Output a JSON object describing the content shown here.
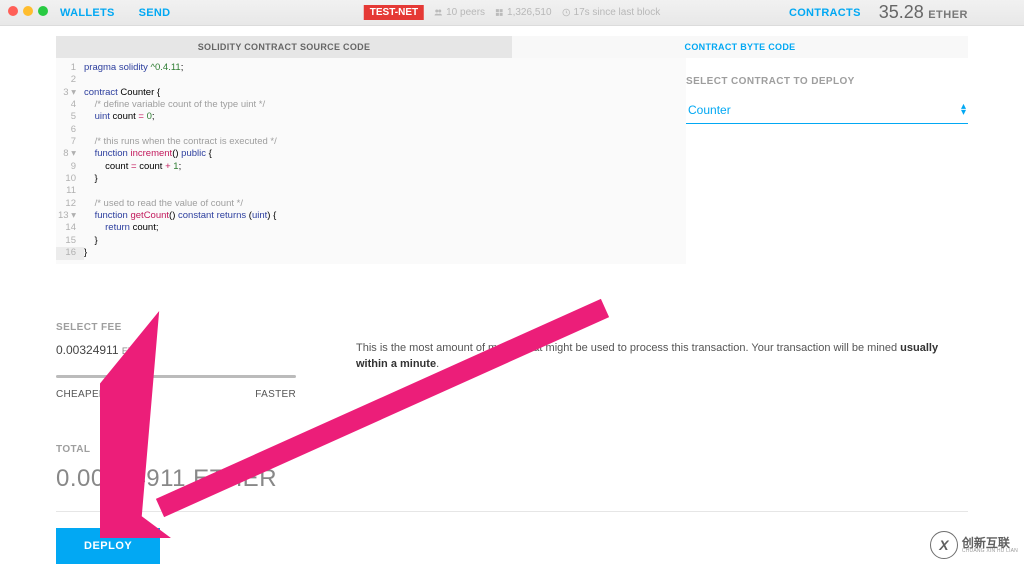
{
  "topbar": {
    "wallets": "WALLETS",
    "send": "SEND",
    "badge": "TEST-NET",
    "peers": "10 peers",
    "block": "1,326,510",
    "since": "17s since last block",
    "contracts": "CONTRACTS",
    "balance_amount": "35.28",
    "balance_unit": "ETHER"
  },
  "tabs": {
    "source": "SOLIDITY CONTRACT SOURCE CODE",
    "byte": "CONTRACT BYTE CODE"
  },
  "code": {
    "l1": "pragma solidity ^0.4.11;",
    "l2": "",
    "l3": "contract Counter {",
    "l4": "    /* define variable count of the type uint */",
    "l5": "    uint count = 0;",
    "l6": "",
    "l7": "    /* this runs when the contract is executed */",
    "l8": "    function increment() public {",
    "l9": "        count = count + 1;",
    "l10": "    }",
    "l11": "",
    "l12": "    /* used to read the value of count */",
    "l13": "    function getCount() constant returns (uint) {",
    "l14": "        return count;",
    "l15": "    }",
    "l16": "}"
  },
  "deploy": {
    "label": "SELECT CONTRACT TO DEPLOY",
    "selected": "Counter"
  },
  "fee": {
    "label": "SELECT FEE",
    "value": "0.00324911",
    "unit": "ETHER",
    "cheaper": "CHEAPER",
    "faster": "FASTER",
    "info_pre": "This is the most amount of money that might be used to process this transaction. Your transaction will be mined ",
    "info_bold": "usually within a minute",
    "info_post": "."
  },
  "total": {
    "label": "TOTAL",
    "value": "0.00324911 ETHER"
  },
  "button": {
    "deploy": "DEPLOY"
  },
  "watermark": {
    "cn": "创新互联",
    "py": "CHUANG XIN HU LIAN"
  }
}
